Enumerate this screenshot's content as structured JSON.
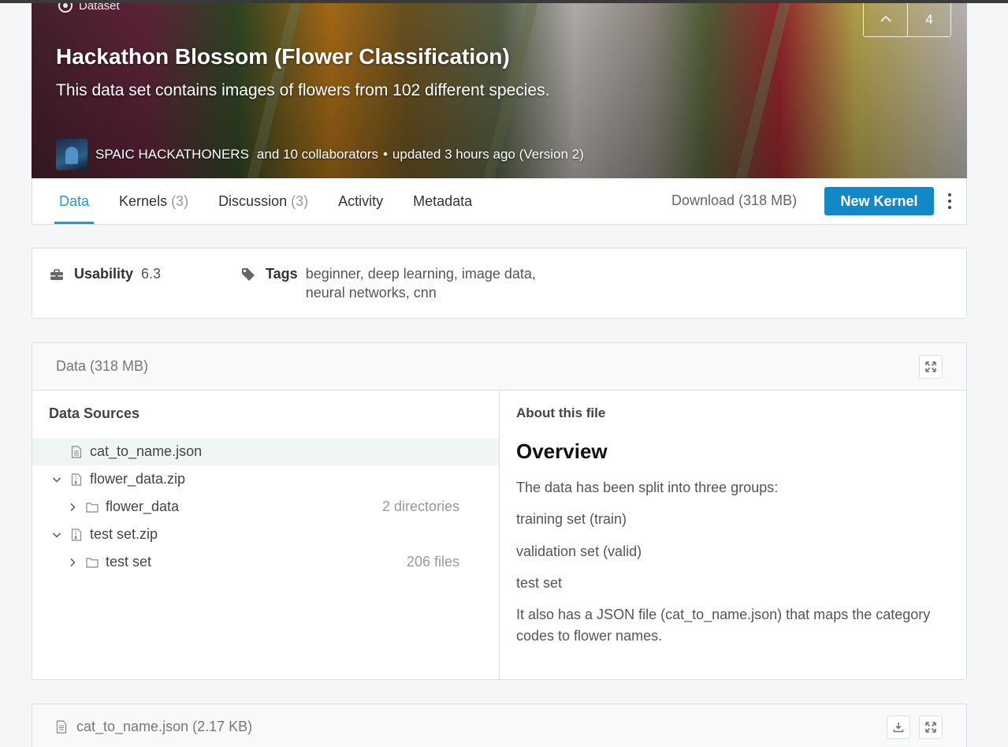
{
  "banner": {
    "type_label": "Dataset",
    "title": "Hackathon Blossom (Flower Classification)",
    "subtitle": "This data set contains images of flowers from 102 different species.",
    "owner": "SPAIC HACKATHONERS",
    "collaborators": "and 10 collaborators",
    "bullet": "•",
    "updated": "updated 3 hours ago (Version 2)",
    "vote_count": "4"
  },
  "nav": {
    "tabs": [
      {
        "label": "Data",
        "count": ""
      },
      {
        "label": "Kernels",
        "count": "(3)"
      },
      {
        "label": "Discussion",
        "count": "(3)"
      },
      {
        "label": "Activity",
        "count": ""
      },
      {
        "label": "Metadata",
        "count": ""
      }
    ],
    "download": "Download (318 MB)",
    "new_kernel": "New Kernel"
  },
  "usability": {
    "label": "Usability",
    "value": "6.3",
    "tags_label": "Tags",
    "tags_line1": "beginner, deep learning, image data,",
    "tags_line2": "neural networks, cnn"
  },
  "data_card": {
    "title": "Data (318 MB)",
    "sources_title": "Data Sources",
    "tree": [
      {
        "name": "cat_to_name.json",
        "meta": ""
      },
      {
        "name": "flower_data.zip",
        "meta": ""
      },
      {
        "name": "flower_data",
        "meta": "2 directories"
      },
      {
        "name": "test set.zip",
        "meta": ""
      },
      {
        "name": "test set",
        "meta": "206 files"
      }
    ],
    "about_title": "About this file",
    "overview": "Overview",
    "paragraphs": [
      "The data has been split into three groups:",
      "training set (train)",
      "validation set (valid)",
      "test set",
      "It also has a JSON file (cat_to_name.json) that maps the category codes to flower names."
    ]
  },
  "file_card": {
    "title": "cat_to_name.json (2.17 KB)"
  },
  "colors": {
    "accent": "#1c9bd0",
    "button": "#1288c7"
  }
}
